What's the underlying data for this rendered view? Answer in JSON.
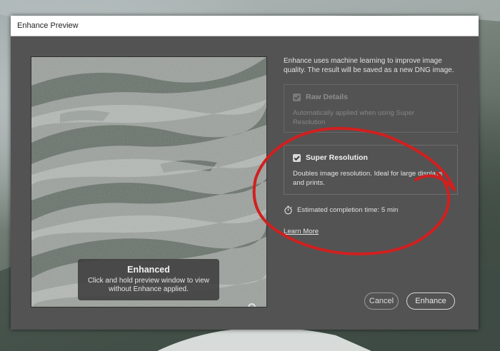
{
  "window": {
    "title": "Enhance Preview"
  },
  "preview": {
    "overlay_title": "Enhanced",
    "overlay_text_line1": "Click and hold preview window to view",
    "overlay_text_line2": "without Enhance applied.",
    "zoom_icon": "zoom-icon"
  },
  "description_line1": "Enhance uses machine learning to improve image",
  "description_line2": "quality. The result will be saved as a new DNG image.",
  "options": {
    "raw_details": {
      "label": "Raw Details",
      "checked": true,
      "enabled": false,
      "note_line1": "Automatically applied when using Super",
      "note_line2": "Resolution"
    },
    "super_resolution": {
      "label": "Super Resolution",
      "checked": true,
      "enabled": true,
      "note_line1": "Doubles image resolution. Ideal for large displays",
      "note_line2": "and prints."
    }
  },
  "estimate": {
    "icon": "stopwatch-icon",
    "text": "Estimated completion time: 5 min"
  },
  "learn_more": "Learn More",
  "buttons": {
    "cancel": "Cancel",
    "enhance": "Enhance"
  },
  "annotation_color": "#d0201f"
}
